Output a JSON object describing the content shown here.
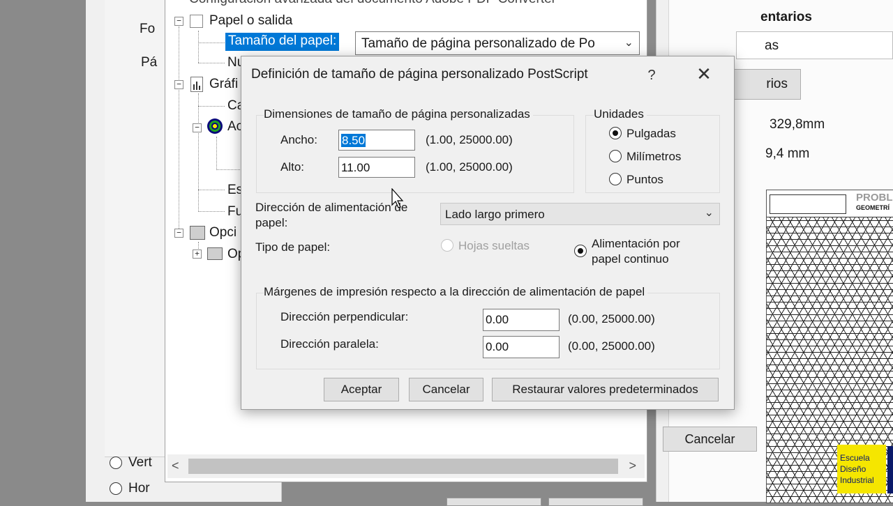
{
  "background": {
    "left_panel": {
      "label_fo": "Fo",
      "label_pa": "Pá",
      "radio_vertical": "Vert",
      "radio_horizontal": "Hor"
    },
    "advanced_window": {
      "title": "Configuración avanzada del documento Adobe PDF Converter",
      "tree": {
        "paper_output": "Papel o salida",
        "paper_size_label": "Tamaño del papel:",
        "paper_size_value": "Tamaño de página personalizado de Po",
        "item_nu": "Nu",
        "graphics": "Gráfi",
        "item_ca": "Ca",
        "item_ac": "Ac",
        "item_es": "Es",
        "item_fu": "Fu",
        "options": "Opci",
        "item_op": "Op"
      }
    },
    "right_panel": {
      "header": "entarios",
      "field1": "as",
      "button_rios": "rios",
      "measure1": "329,8mm",
      "measure2": "9,4 mm",
      "cancel": "Cancelar",
      "preview_header1": "PROBL",
      "preview_header2": "GEOMETRÍ",
      "logo_line1": "Escuela",
      "logo_line2": "Diseño",
      "logo_line3": "Industrial"
    }
  },
  "dialog": {
    "title": "Definición de tamaño de página personalizado PostScript",
    "help": "?",
    "close": "✕",
    "dimensions": {
      "group_label": "Dimensiones de tamaño de página personalizadas",
      "width_label": "Ancho:",
      "width_value": "8.50",
      "width_range": "(1.00, 25000.00)",
      "height_label": "Alto:",
      "height_value": "11.00",
      "height_range": "(1.00, 25000.00)"
    },
    "units": {
      "group_label": "Unidades",
      "options": [
        "Pulgadas",
        "Milímetros",
        "Puntos"
      ],
      "selected": "Pulgadas"
    },
    "feed_direction": {
      "label_line1": "Dirección de alimentación de",
      "label_line2": "papel:",
      "value": "Lado largo primero"
    },
    "paper_type": {
      "label": "Tipo de papel:",
      "option_sheets": "Hojas sueltas",
      "option_continuous_line1": "Alimentación por",
      "option_continuous_line2": "papel continuo",
      "selected": "Alimentación por papel continuo"
    },
    "margins": {
      "group_label": "Márgenes de impresión respecto a la dirección de alimentación de papel",
      "perpendicular_label": "Dirección perpendicular:",
      "perpendicular_value": "0.00",
      "perpendicular_range": "(0.00, 25000.00)",
      "parallel_label": "Dirección paralela:",
      "parallel_value": "0.00",
      "parallel_range": "(0.00, 25000.00)"
    },
    "buttons": {
      "accept": "Aceptar",
      "cancel": "Cancelar",
      "restore": "Restaurar valores predeterminados"
    }
  },
  "colors": {
    "selection": "#0078d7",
    "dialog_bg": "#f0f0f0",
    "logo_yellow": "#f5e600"
  }
}
